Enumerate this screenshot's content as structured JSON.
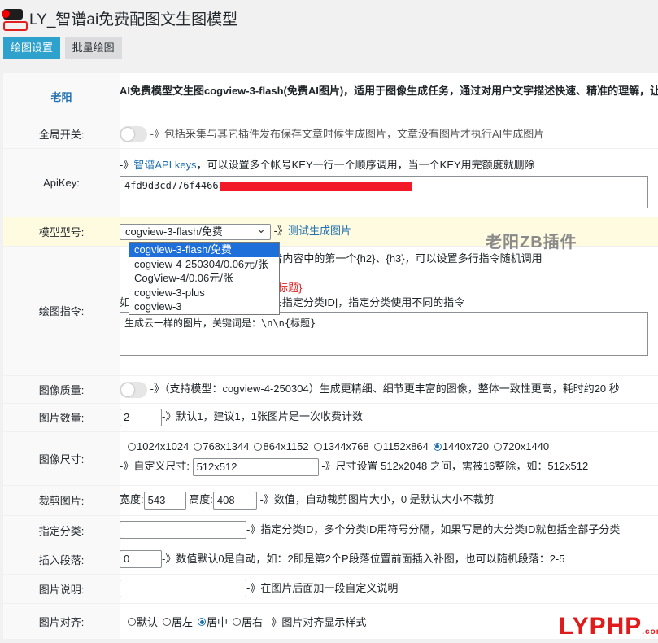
{
  "header": {
    "title": "LY_智谱ai免费配图文生图模型"
  },
  "tabs": [
    "绘图设置",
    "批量绘图"
  ],
  "intro": {
    "author": "老阳",
    "description": "AI免费模型文生图cogview-3-flash(免费AI图片)，适用于图像生成任务，通过对用户文字描述快速、精准的理解，让"
  },
  "global_switch": {
    "label": "全局开关:",
    "desc": "-》包括采集与其它插件发布保存文章时候生成图片，文章没有图片才执行AI生成图片"
  },
  "apikey": {
    "label": "ApiKey:",
    "arrow": "-》",
    "link": "智谱API keys",
    "desc": "，可以设置多个帐号KEY一行一个顺序调用，当一个KEY用完额度就删除",
    "value_prefix": "4fd9d3cd776f4466"
  },
  "model": {
    "label": "模型型号:",
    "selected": "cogview-3-flash/免费",
    "arrow": "-》",
    "link": "测试生成图片",
    "options": [
      "cogview-3-flash/免费",
      "cogview-4-250304/0.06元/张",
      "CogView-4/0.06元/张",
      "cogview-3-plus",
      "cogview-3"
    ]
  },
  "prompt": {
    "label": "绘图指令:",
    "line1": "签)或者内容中的第一个{h2}、{h3}，可以设置多行指令随机调用",
    "line2": "题}",
    "line3": "\\n{标题}",
    "line4": "如：20|自定义指令，支持输入门头指定分类ID|，指定分类使用不同的指令",
    "value": "生成云一样的图片，关键词是：\\n\\n{标题}"
  },
  "quality": {
    "label": "图像质量:",
    "desc": "-》（支持模型：cogview-4-250304）生成更精细、细节更丰富的图像，整体一致性更高，耗时约20 秒"
  },
  "count": {
    "label": "图片数量:",
    "value": "2",
    "desc": "-》默认1，建议1，1张图片是一次收费计数"
  },
  "size": {
    "label": "图像尺寸:",
    "options": [
      "1024x1024",
      "768x1344",
      "864x1152",
      "1344x768",
      "1152x864",
      "1440x720",
      "720x1440"
    ],
    "selected_index": 5,
    "custom_label": "-》自定义尺寸:",
    "custom_value": "512x512",
    "custom_desc": "-》尺寸设置 512x2048 之间，需被16整除，如：512x512"
  },
  "crop": {
    "label": "裁剪图片:",
    "width_label": "宽度:",
    "width": "543",
    "height_label": "高度:",
    "height": "408",
    "desc": "-》数值，自动裁剪图片大小，0 是默认大小不裁剪"
  },
  "category": {
    "label": "指定分类:",
    "value": "",
    "desc": "-》指定分类ID，多个分类ID用符号分隔，如果写是的大分类ID就包括全部子分类"
  },
  "insert": {
    "label": "插入段落:",
    "value": "0",
    "desc": "-》数值默认0是自动，如：2即是第2个P段落位置前面插入补图，也可以随机段落：2-5"
  },
  "caption": {
    "label": "图片说明:",
    "value": "",
    "desc": "-》在图片后面加一段自定义说明"
  },
  "align": {
    "label": "图片对齐:",
    "options": [
      "默认",
      "居左",
      "居中",
      "居右"
    ],
    "selected_index": 2,
    "desc": "-》图片对齐显示样式"
  },
  "watermarks": {
    "center": "老阳ZB插件",
    "corner_a": "LY",
    "corner_b": "PHP",
    "corner_c": ".com"
  },
  "colors": {
    "accent": "#2ea2cc",
    "link": "#2271b1",
    "warning": "#e01b1b"
  }
}
